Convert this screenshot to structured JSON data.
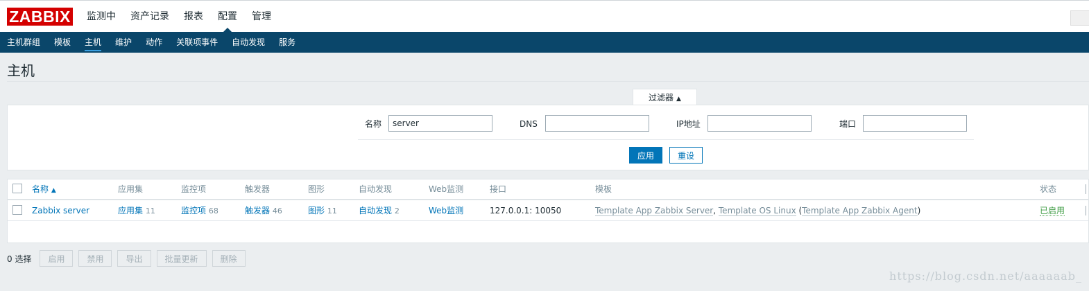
{
  "app": {
    "logo_text": "ZABBIX",
    "brand_color": "#d40000"
  },
  "topnav": [
    {
      "label": "监测中"
    },
    {
      "label": "资产记录"
    },
    {
      "label": "报表"
    },
    {
      "label": "配置"
    },
    {
      "label": "管理"
    }
  ],
  "subnav": [
    {
      "label": "主机群组"
    },
    {
      "label": "模板"
    },
    {
      "label": "主机"
    },
    {
      "label": "维护"
    },
    {
      "label": "动作"
    },
    {
      "label": "关联项事件"
    },
    {
      "label": "自动发现"
    },
    {
      "label": "服务"
    }
  ],
  "page": {
    "title": "主机"
  },
  "filter": {
    "tab_label": "过滤器",
    "name_label": "名称",
    "name_value": "server",
    "dns_label": "DNS",
    "dns_value": "",
    "ip_label": "IP地址",
    "ip_value": "",
    "port_label": "端口",
    "port_value": "",
    "apply_label": "应用",
    "reset_label": "重设"
  },
  "table": {
    "headers": {
      "name": "名称",
      "applications": "应用集",
      "items": "监控项",
      "triggers": "触发器",
      "graphs": "图形",
      "discovery": "自动发现",
      "web": "Web监测",
      "interface": "接口",
      "templates": "模板",
      "status": "状态"
    },
    "rows": [
      {
        "name": "Zabbix server",
        "applications": "应用集",
        "applications_count": "11",
        "items": "监控项",
        "items_count": "68",
        "triggers": "触发器",
        "triggers_count": "46",
        "graphs": "图形",
        "graphs_count": "11",
        "discovery": "自动发现",
        "discovery_count": "2",
        "web": "Web监测",
        "interface": "127.0.0.1: 10050",
        "template1": "Template App Zabbix Server",
        "sep1": ", ",
        "template2": "Template OS Linux",
        "paren_open": " (",
        "template3": "Template App Zabbix Agent",
        "paren_close": ")",
        "status": "已启用"
      }
    ]
  },
  "footer": {
    "selected": "0 选择",
    "buttons": [
      "启用",
      "禁用",
      "导出",
      "批量更新",
      "删除"
    ]
  },
  "watermark": "https://blog.csdn.net/aaaaaab_"
}
